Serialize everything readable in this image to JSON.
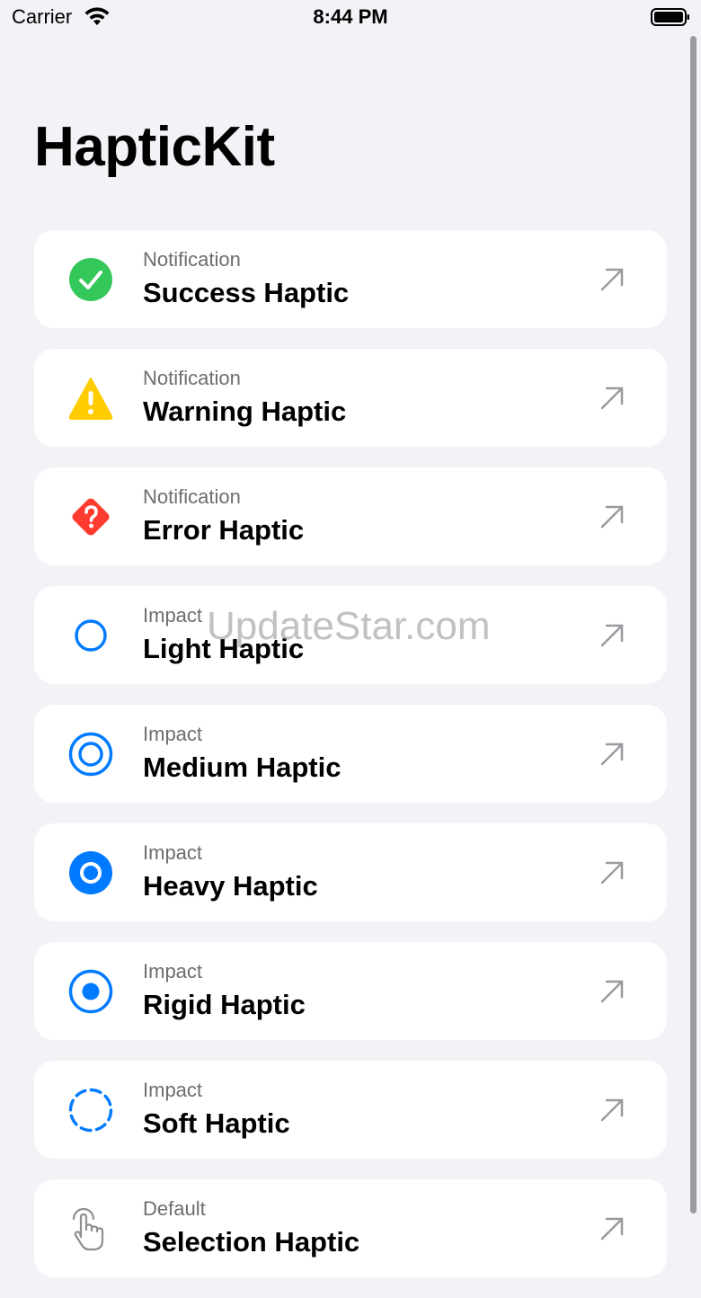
{
  "status_bar": {
    "carrier": "Carrier",
    "time": "8:44 PM"
  },
  "header": {
    "title": "HapticKit"
  },
  "items": [
    {
      "category": "Notification",
      "label": "Success Haptic",
      "icon": "checkmark-circle-icon",
      "color": "#34c759"
    },
    {
      "category": "Notification",
      "label": "Warning Haptic",
      "icon": "warning-triangle-icon",
      "color": "#ffcc00"
    },
    {
      "category": "Notification",
      "label": "Error Haptic",
      "icon": "question-diamond-icon",
      "color": "#ff3b30"
    },
    {
      "category": "Impact",
      "label": "Light Haptic",
      "icon": "circle-outline-icon",
      "color": "#007aff"
    },
    {
      "category": "Impact",
      "label": "Medium Haptic",
      "icon": "double-circle-icon",
      "color": "#007aff"
    },
    {
      "category": "Impact",
      "label": "Heavy Haptic",
      "icon": "filled-ring-icon",
      "color": "#007aff"
    },
    {
      "category": "Impact",
      "label": "Rigid Haptic",
      "icon": "record-circle-icon",
      "color": "#007aff"
    },
    {
      "category": "Impact",
      "label": "Soft Haptic",
      "icon": "dashed-circle-icon",
      "color": "#007aff"
    },
    {
      "category": "Default",
      "label": "Selection Haptic",
      "icon": "hand-tap-icon",
      "color": "#8e8e93"
    }
  ],
  "watermark": "UpdateStar.com"
}
